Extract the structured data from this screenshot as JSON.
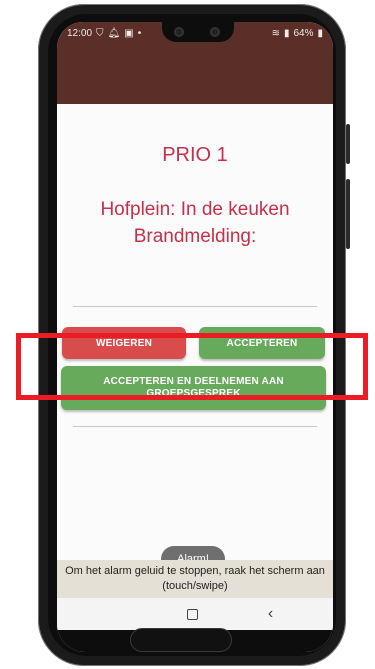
{
  "status_bar": {
    "time": "12:00",
    "battery": "64%",
    "left_icons": [
      "shield-icon",
      "bell-icon",
      "image-icon",
      "dot-icon"
    ],
    "right_icons": [
      "wifi-icon",
      "signal-icon",
      "battery-icon"
    ]
  },
  "alarm": {
    "priority": "PRIO 1",
    "location_line1": "Hofplein: In de keuken",
    "location_line2": "Brandmelding:"
  },
  "buttons": {
    "refuse": "WEIGEREN",
    "accept": "ACCEPTEREN",
    "accept_join": "ACCEPTEREN EN DEELNEMEN AAN GROEPSGESPREK"
  },
  "toast": {
    "text": "Alarm!"
  },
  "notice": {
    "text": "Om het alarm geluid te stoppen, raak het scherm aan (touch/swipe)"
  },
  "colors": {
    "header": "#5a2f27",
    "alert_text": "#c6304a",
    "refuse": "#d94c4c",
    "accept": "#67aa5c",
    "highlight": "#ec1c24"
  }
}
